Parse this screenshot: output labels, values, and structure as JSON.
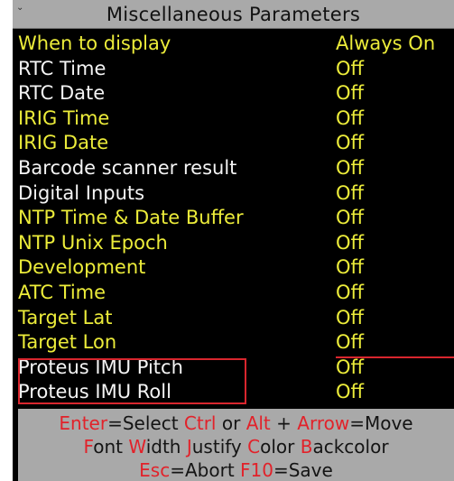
{
  "title": "Miscellaneous Parameters",
  "rows": [
    {
      "label": "When to display",
      "value": "Always On",
      "color": "yellow"
    },
    {
      "label": "RTC Time",
      "value": "Off",
      "color": "white"
    },
    {
      "label": "RTC Date",
      "value": "Off",
      "color": "white"
    },
    {
      "label": "IRIG Time",
      "value": "Off",
      "color": "yellow"
    },
    {
      "label": "IRIG Date",
      "value": "Off",
      "color": "yellow"
    },
    {
      "label": "Barcode scanner result",
      "value": "Off",
      "color": "white"
    },
    {
      "label": "Digital Inputs",
      "value": "Off",
      "color": "white"
    },
    {
      "label": "NTP Time & Date Buffer",
      "value": "Off",
      "color": "yellow"
    },
    {
      "label": "NTP Unix Epoch",
      "value": "Off",
      "color": "yellow"
    },
    {
      "label": "Development",
      "value": "Off",
      "color": "yellow"
    },
    {
      "label": "ATC Time",
      "value": "Off",
      "color": "yellow"
    },
    {
      "label": "Target Lat",
      "value": "Off",
      "color": "yellow"
    },
    {
      "label": "Target Lon",
      "value": "Off",
      "color": "yellow"
    },
    {
      "label": "Proteus IMU Pitch",
      "value": "Off",
      "color": "white"
    },
    {
      "label": "Proteus IMU Roll",
      "value": "Off",
      "color": "white"
    }
  ],
  "hints": {
    "line1": {
      "enter": "Enter",
      "select": "=Select ",
      "ctrl": "Ctrl",
      "or": " or ",
      "alt": "Alt",
      "plus": " + ",
      "arrow": "Arrow",
      "move": "=Move"
    },
    "line2": {
      "font": "Font",
      "width_w": "W",
      "width_rest": "idth ",
      "justify_j": "J",
      "justify_rest": "ustify ",
      "color_c": "C",
      "color_rest": "olor ",
      "back_b": "B",
      "back_rest": "ackcolor"
    },
    "line3": {
      "esc": "Esc",
      "abort": "=Abort ",
      "f10": "F10",
      "save": "=Save"
    }
  },
  "colors": {
    "yellow": "#ecec3a",
    "white": "#f4f4f4",
    "red": "#d9262e",
    "titlebar": "#a9a9a9",
    "background": "#000000"
  }
}
